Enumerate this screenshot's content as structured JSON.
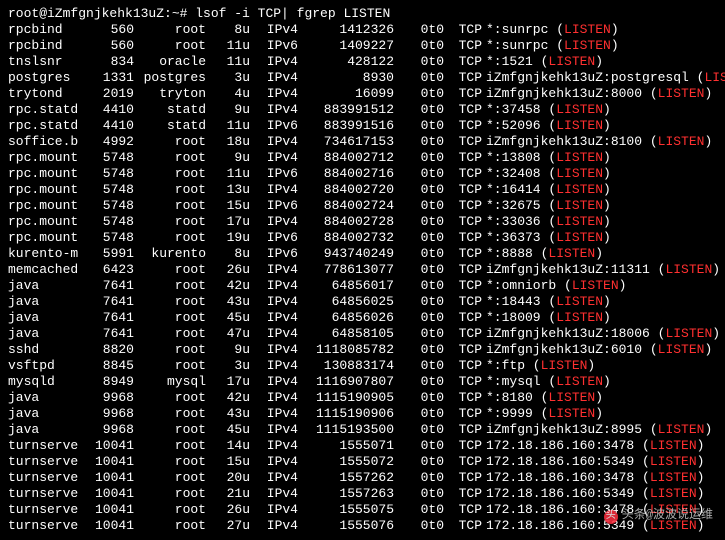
{
  "prompt": "root@iZmfgnjkehk13uZ:~# lsof -i TCP| fgrep LISTEN",
  "watermark": "头条@波波说运维",
  "watermark_icon": "头",
  "listen": "LISTEN",
  "rows": [
    {
      "cmd": "rpcbind",
      "pid": "560",
      "user": "root",
      "fd": "8u",
      "proto": "IPv4",
      "node": "1412326",
      "dev": "0t0",
      "t": "TCP",
      "name": "*:sunrpc"
    },
    {
      "cmd": "rpcbind",
      "pid": "560",
      "user": "root",
      "fd": "11u",
      "proto": "IPv6",
      "node": "1409227",
      "dev": "0t0",
      "t": "TCP",
      "name": "*:sunrpc"
    },
    {
      "cmd": "tnslsnr",
      "pid": "834",
      "user": "oracle",
      "fd": "11u",
      "proto": "IPv4",
      "node": "428122",
      "dev": "0t0",
      "t": "TCP",
      "name": "*:1521"
    },
    {
      "cmd": "postgres",
      "pid": "1331",
      "user": "postgres",
      "fd": "3u",
      "proto": "IPv4",
      "node": "8930",
      "dev": "0t0",
      "t": "TCP",
      "name": "iZmfgnjkehk13uZ:postgresql"
    },
    {
      "cmd": "trytond",
      "pid": "2019",
      "user": "tryton",
      "fd": "4u",
      "proto": "IPv4",
      "node": "16099",
      "dev": "0t0",
      "t": "TCP",
      "name": "iZmfgnjkehk13uZ:8000"
    },
    {
      "cmd": "rpc.statd",
      "pid": "4410",
      "user": "statd",
      "fd": "9u",
      "proto": "IPv4",
      "node": "883991512",
      "dev": "0t0",
      "t": "TCP",
      "name": "*:37458"
    },
    {
      "cmd": "rpc.statd",
      "pid": "4410",
      "user": "statd",
      "fd": "11u",
      "proto": "IPv6",
      "node": "883991516",
      "dev": "0t0",
      "t": "TCP",
      "name": "*:52096"
    },
    {
      "cmd": "soffice.b",
      "pid": "4992",
      "user": "root",
      "fd": "18u",
      "proto": "IPv4",
      "node": "734617153",
      "dev": "0t0",
      "t": "TCP",
      "name": "iZmfgnjkehk13uZ:8100"
    },
    {
      "cmd": "rpc.mount",
      "pid": "5748",
      "user": "root",
      "fd": "9u",
      "proto": "IPv4",
      "node": "884002712",
      "dev": "0t0",
      "t": "TCP",
      "name": "*:13808"
    },
    {
      "cmd": "rpc.mount",
      "pid": "5748",
      "user": "root",
      "fd": "11u",
      "proto": "IPv6",
      "node": "884002716",
      "dev": "0t0",
      "t": "TCP",
      "name": "*:32408"
    },
    {
      "cmd": "rpc.mount",
      "pid": "5748",
      "user": "root",
      "fd": "13u",
      "proto": "IPv4",
      "node": "884002720",
      "dev": "0t0",
      "t": "TCP",
      "name": "*:16414"
    },
    {
      "cmd": "rpc.mount",
      "pid": "5748",
      "user": "root",
      "fd": "15u",
      "proto": "IPv6",
      "node": "884002724",
      "dev": "0t0",
      "t": "TCP",
      "name": "*:32675"
    },
    {
      "cmd": "rpc.mount",
      "pid": "5748",
      "user": "root",
      "fd": "17u",
      "proto": "IPv4",
      "node": "884002728",
      "dev": "0t0",
      "t": "TCP",
      "name": "*:33036"
    },
    {
      "cmd": "rpc.mount",
      "pid": "5748",
      "user": "root",
      "fd": "19u",
      "proto": "IPv6",
      "node": "884002732",
      "dev": "0t0",
      "t": "TCP",
      "name": "*:36373"
    },
    {
      "cmd": "kurento-m",
      "pid": "5991",
      "user": "kurento",
      "fd": "8u",
      "proto": "IPv6",
      "node": "943740249",
      "dev": "0t0",
      "t": "TCP",
      "name": "*:8888"
    },
    {
      "cmd": "memcached",
      "pid": "6423",
      "user": "root",
      "fd": "26u",
      "proto": "IPv4",
      "node": "778613077",
      "dev": "0t0",
      "t": "TCP",
      "name": "iZmfgnjkehk13uZ:11311"
    },
    {
      "cmd": "java",
      "pid": "7641",
      "user": "root",
      "fd": "42u",
      "proto": "IPv4",
      "node": "64856017",
      "dev": "0t0",
      "t": "TCP",
      "name": "*:omniorb"
    },
    {
      "cmd": "java",
      "pid": "7641",
      "user": "root",
      "fd": "43u",
      "proto": "IPv4",
      "node": "64856025",
      "dev": "0t0",
      "t": "TCP",
      "name": "*:18443"
    },
    {
      "cmd": "java",
      "pid": "7641",
      "user": "root",
      "fd": "45u",
      "proto": "IPv4",
      "node": "64856026",
      "dev": "0t0",
      "t": "TCP",
      "name": "*:18009"
    },
    {
      "cmd": "java",
      "pid": "7641",
      "user": "root",
      "fd": "47u",
      "proto": "IPv4",
      "node": "64858105",
      "dev": "0t0",
      "t": "TCP",
      "name": "iZmfgnjkehk13uZ:18006"
    },
    {
      "cmd": "sshd",
      "pid": "8820",
      "user": "root",
      "fd": "9u",
      "proto": "IPv4",
      "node": "1118085782",
      "dev": "0t0",
      "t": "TCP",
      "name": "iZmfgnjkehk13uZ:6010"
    },
    {
      "cmd": "vsftpd",
      "pid": "8845",
      "user": "root",
      "fd": "3u",
      "proto": "IPv4",
      "node": "130883174",
      "dev": "0t0",
      "t": "TCP",
      "name": "*:ftp"
    },
    {
      "cmd": "mysqld",
      "pid": "8949",
      "user": "mysql",
      "fd": "17u",
      "proto": "IPv4",
      "node": "1116907807",
      "dev": "0t0",
      "t": "TCP",
      "name": "*:mysql"
    },
    {
      "cmd": "java",
      "pid": "9968",
      "user": "root",
      "fd": "42u",
      "proto": "IPv4",
      "node": "1115190905",
      "dev": "0t0",
      "t": "TCP",
      "name": "*:8180"
    },
    {
      "cmd": "java",
      "pid": "9968",
      "user": "root",
      "fd": "43u",
      "proto": "IPv4",
      "node": "1115190906",
      "dev": "0t0",
      "t": "TCP",
      "name": "*:9999"
    },
    {
      "cmd": "java",
      "pid": "9968",
      "user": "root",
      "fd": "45u",
      "proto": "IPv4",
      "node": "1115193500",
      "dev": "0t0",
      "t": "TCP",
      "name": "iZmfgnjkehk13uZ:8995"
    },
    {
      "cmd": "turnserve",
      "pid": "10041",
      "user": "root",
      "fd": "14u",
      "proto": "IPv4",
      "node": "1555071",
      "dev": "0t0",
      "t": "TCP",
      "name": "172.18.186.160:3478"
    },
    {
      "cmd": "turnserve",
      "pid": "10041",
      "user": "root",
      "fd": "15u",
      "proto": "IPv4",
      "node": "1555072",
      "dev": "0t0",
      "t": "TCP",
      "name": "172.18.186.160:5349"
    },
    {
      "cmd": "turnserve",
      "pid": "10041",
      "user": "root",
      "fd": "20u",
      "proto": "IPv4",
      "node": "1557262",
      "dev": "0t0",
      "t": "TCP",
      "name": "172.18.186.160:3478"
    },
    {
      "cmd": "turnserve",
      "pid": "10041",
      "user": "root",
      "fd": "21u",
      "proto": "IPv4",
      "node": "1557263",
      "dev": "0t0",
      "t": "TCP",
      "name": "172.18.186.160:5349"
    },
    {
      "cmd": "turnserve",
      "pid": "10041",
      "user": "root",
      "fd": "26u",
      "proto": "IPv4",
      "node": "1555075",
      "dev": "0t0",
      "t": "TCP",
      "name": "172.18.186.160:3478"
    },
    {
      "cmd": "turnserve",
      "pid": "10041",
      "user": "root",
      "fd": "27u",
      "proto": "IPv4",
      "node": "1555076",
      "dev": "0t0",
      "t": "TCP",
      "name": "172.18.186.160:5349"
    }
  ]
}
